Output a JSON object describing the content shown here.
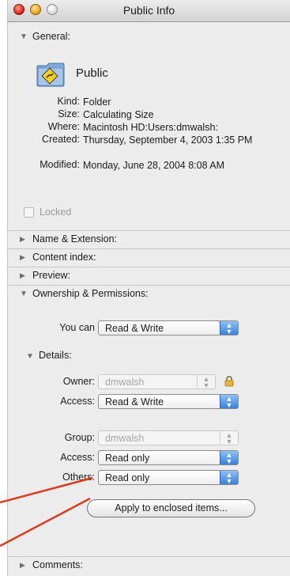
{
  "window": {
    "title": "Public Info"
  },
  "general": {
    "header": "General:",
    "name": "Public",
    "fields": [
      {
        "key": "Kind:",
        "value": "Folder"
      },
      {
        "key": "Size:",
        "value": "Calculating Size"
      },
      {
        "key": "Where:",
        "value": "Macintosh HD:Users:dmwalsh:"
      },
      {
        "key": "Created:",
        "value": "Thursday, September 4, 2003 1:35 PM"
      },
      {
        "key": "Modified:",
        "value": "Monday, June 28, 2004 8:08 AM"
      }
    ],
    "locked_label": "Locked",
    "locked_checked": false
  },
  "sections": {
    "name_ext": "Name & Extension:",
    "content_index": "Content index:",
    "preview": "Preview:",
    "ownership": "Ownership & Permissions:",
    "comments": "Comments:"
  },
  "permissions": {
    "you_can_label": "You can",
    "you_can_value": "Read & Write",
    "details_label": "Details:",
    "owner_label": "Owner:",
    "owner_value": "dmwalsh",
    "owner_access_label": "Access:",
    "owner_access_value": "Read & Write",
    "group_label": "Group:",
    "group_value": "dmwalsh",
    "group_access_label": "Access:",
    "group_access_value": "Read only",
    "others_label": "Others:",
    "others_value": "Read only",
    "apply_button": "Apply to enclosed items..."
  },
  "icons": {
    "folder": "folder-with-sign-icon",
    "lock": "lock-icon",
    "disclosure_open": "triangle-down-icon",
    "disclosure_closed": "triangle-right-icon"
  },
  "colors": {
    "annotation": "#e03a1c",
    "popup_accent": "#3b80dc"
  }
}
